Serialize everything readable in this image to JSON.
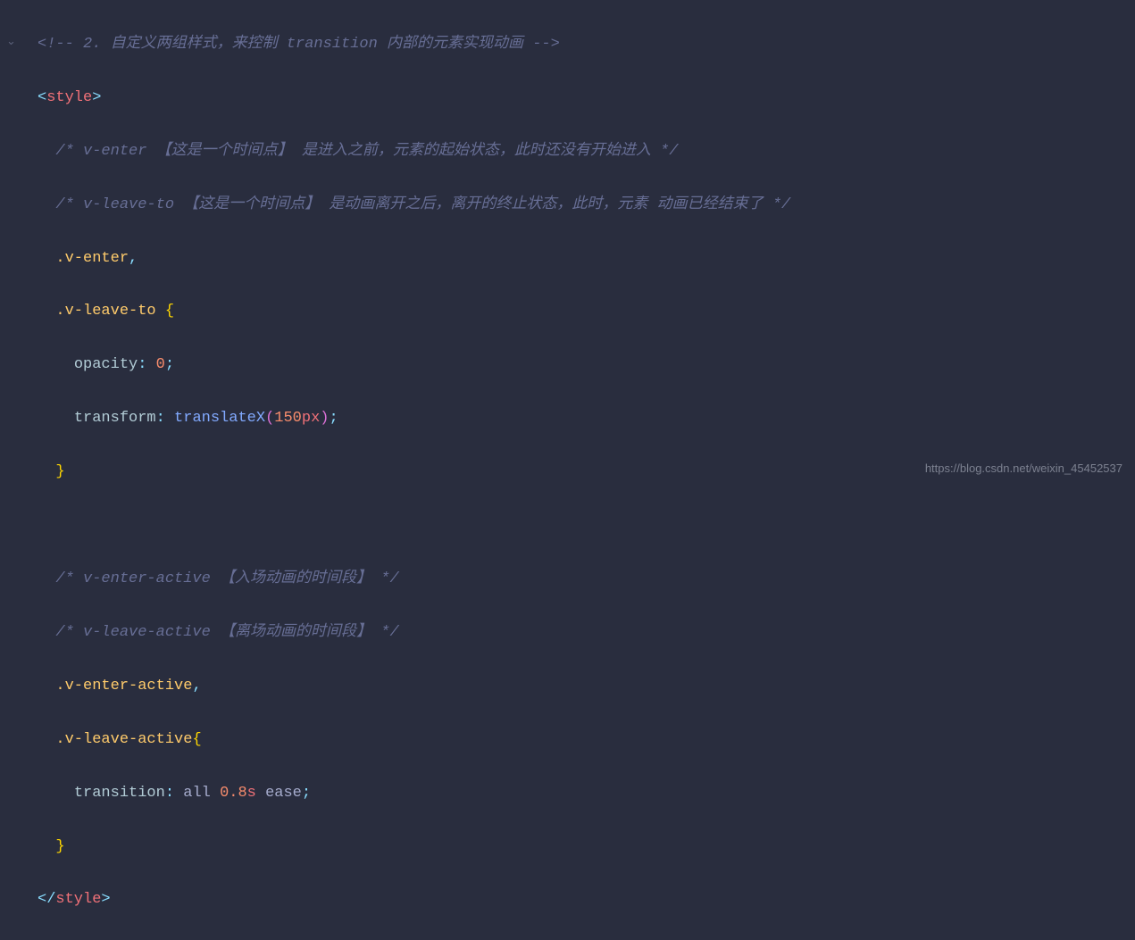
{
  "code": {
    "line1_comment": "<!-- 2. 自定义两组样式，来控制 transition 内部的元素实现动画 -->",
    "open_bracket": "<",
    "close_bracket": ">",
    "style_tag": "style",
    "slash": "/",
    "comment_venter": "/* v-enter 【这是一个时间点】 是进入之前，元素的起始状态，此时还没有开始进入 */",
    "comment_vleave": "/* v-leave-to 【这是一个时间点】 是动画离开之后，离开的终止状态，此时，元素 动画已经结束了 */",
    "sel_venter": ".v-enter",
    "comma": ",",
    "sel_vleaveto": ".v-leave-to",
    "space_brace_open": " {",
    "brace_open": "{",
    "brace_close": "}",
    "prop_opacity": "opacity",
    "colon_space": ": ",
    "val_zero": "0",
    "semicolon": ";",
    "prop_transform": "transform",
    "func_translatex": "translateX",
    "paren_open": "(",
    "paren_close": ")",
    "val_150": "150",
    "unit_px": "px",
    "comment_enter_active": "/* v-enter-active 【入场动画的时间段】 */",
    "comment_leave_active": "/* v-leave-active 【离场动画的时间段】 */",
    "sel_venter_active": ".v-enter-active",
    "sel_vleave_active": ".v-leave-active",
    "prop_transition": "transition",
    "val_all": "all ",
    "val_08": "0.8",
    "unit_s": "s",
    "val_ease": " ease",
    "indent1": "  ",
    "indent2": "    ",
    "indent3": "      "
  },
  "watermark": "https://blog.csdn.net/weixin_45452537",
  "fold_arrow": "⌄"
}
